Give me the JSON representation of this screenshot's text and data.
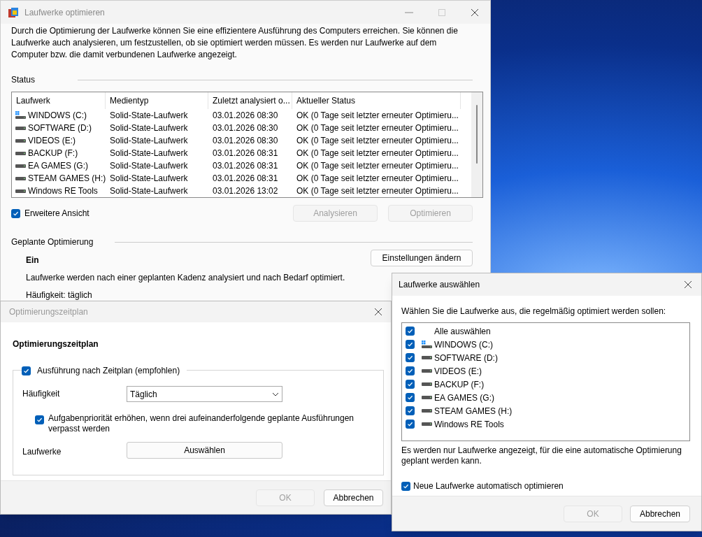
{
  "main_window": {
    "title": "Laufwerke optimieren",
    "description": "Durch die Optimierung der Laufwerke können Sie eine effizientere Ausführung des Computers erreichen. Sie können die Laufwerke auch analysieren, um festzustellen, ob sie optimiert werden müssen. Es werden nur Laufwerke auf dem Computer bzw. die damit verbundenen Laufwerke angezeigt.",
    "status_heading": "Status",
    "table": {
      "columns": [
        "Laufwerk",
        "Medientyp",
        "Zuletzt analysiert o...",
        "Aktueller Status"
      ],
      "rows": [
        {
          "kind": "system",
          "cells": [
            "WINDOWS (C:)",
            "Solid-State-Laufwerk",
            "03.01.2026 08:30",
            "OK (0 Tage seit letzter erneuter Optimieru..."
          ]
        },
        {
          "kind": "drive",
          "cells": [
            "SOFTWARE (D:)",
            "Solid-State-Laufwerk",
            "03.01.2026 08:30",
            "OK (0 Tage seit letzter erneuter Optimieru..."
          ]
        },
        {
          "kind": "drive",
          "cells": [
            "VIDEOS (E:)",
            "Solid-State-Laufwerk",
            "03.01.2026 08:30",
            "OK (0 Tage seit letzter erneuter Optimieru..."
          ]
        },
        {
          "kind": "drive",
          "cells": [
            "BACKUP (F:)",
            "Solid-State-Laufwerk",
            "03.01.2026 08:31",
            "OK (0 Tage seit letzter erneuter Optimieru..."
          ]
        },
        {
          "kind": "drive",
          "cells": [
            "EA GAMES (G:)",
            "Solid-State-Laufwerk",
            "03.01.2026 08:31",
            "OK (0 Tage seit letzter erneuter Optimieru..."
          ]
        },
        {
          "kind": "drive",
          "cells": [
            "STEAM GAMES (H:)",
            "Solid-State-Laufwerk",
            "03.01.2026 08:31",
            "OK (0 Tage seit letzter erneuter Optimieru..."
          ]
        },
        {
          "kind": "drive",
          "cells": [
            "Windows RE Tools",
            "Solid-State-Laufwerk",
            "03.01.2026 13:02",
            "OK (0 Tage seit letzter erneuter Optimieru..."
          ]
        }
      ]
    },
    "extended_view": {
      "label": "Erweitere Ansicht",
      "checked": true
    },
    "buttons": [
      {
        "label": "Analysieren",
        "disabled": true
      },
      {
        "label": "Optimieren",
        "disabled": true
      }
    ],
    "schedule": {
      "heading": "Geplante Optimierung",
      "state": "Ein",
      "description": "Laufwerke werden nach einer geplanten Kadenz analysiert und nach Bedarf optimiert.",
      "frequency": "Häufigkeit: täglich",
      "button": "Einstellungen ändern"
    }
  },
  "schedule_dialog": {
    "title": "Optimierungszeitplan",
    "heading": "Optimierungszeitplan",
    "run_on_schedule": {
      "label": "Ausführung nach Zeitplan (empfohlen)",
      "checked": true
    },
    "frequency_label": "Häufigkeit",
    "frequency_value": "Täglich",
    "priority": {
      "label": "Aufgabenpriorität erhöhen, wenn drei aufeinanderfolgende geplante Ausführungen verpasst werden",
      "checked": true
    },
    "drives_label": "Laufwerke",
    "select_button": "Auswählen",
    "buttons": [
      {
        "label": "OK",
        "disabled": true
      },
      {
        "label": "Abbrechen",
        "disabled": false
      }
    ]
  },
  "drives_dialog": {
    "title": "Laufwerke auswählen",
    "instruction": "Wählen Sie die Laufwerke aus, die regelmäßig optimiert werden sollen:",
    "items": [
      {
        "kind": "all",
        "label": "Alle auswählen",
        "checked": true
      },
      {
        "kind": "system",
        "label": "WINDOWS (C:)",
        "checked": true
      },
      {
        "kind": "drive",
        "label": "SOFTWARE (D:)",
        "checked": true
      },
      {
        "kind": "drive",
        "label": "VIDEOS (E:)",
        "checked": true
      },
      {
        "kind": "drive",
        "label": "BACKUP (F:)",
        "checked": true
      },
      {
        "kind": "drive",
        "label": "EA GAMES (G:)",
        "checked": true
      },
      {
        "kind": "drive",
        "label": "STEAM GAMES (H:)",
        "checked": true
      },
      {
        "kind": "drive",
        "label": "Windows RE Tools",
        "checked": true
      }
    ],
    "note": "Es werden nur Laufwerke angezeigt, für die eine automatische Optimierung geplant werden kann.",
    "auto_optimize": {
      "label": "Neue Laufwerke automatisch optimieren",
      "checked": true
    },
    "buttons": [
      {
        "label": "OK",
        "disabled": true
      },
      {
        "label": "Abbrechen",
        "disabled": false
      }
    ]
  }
}
